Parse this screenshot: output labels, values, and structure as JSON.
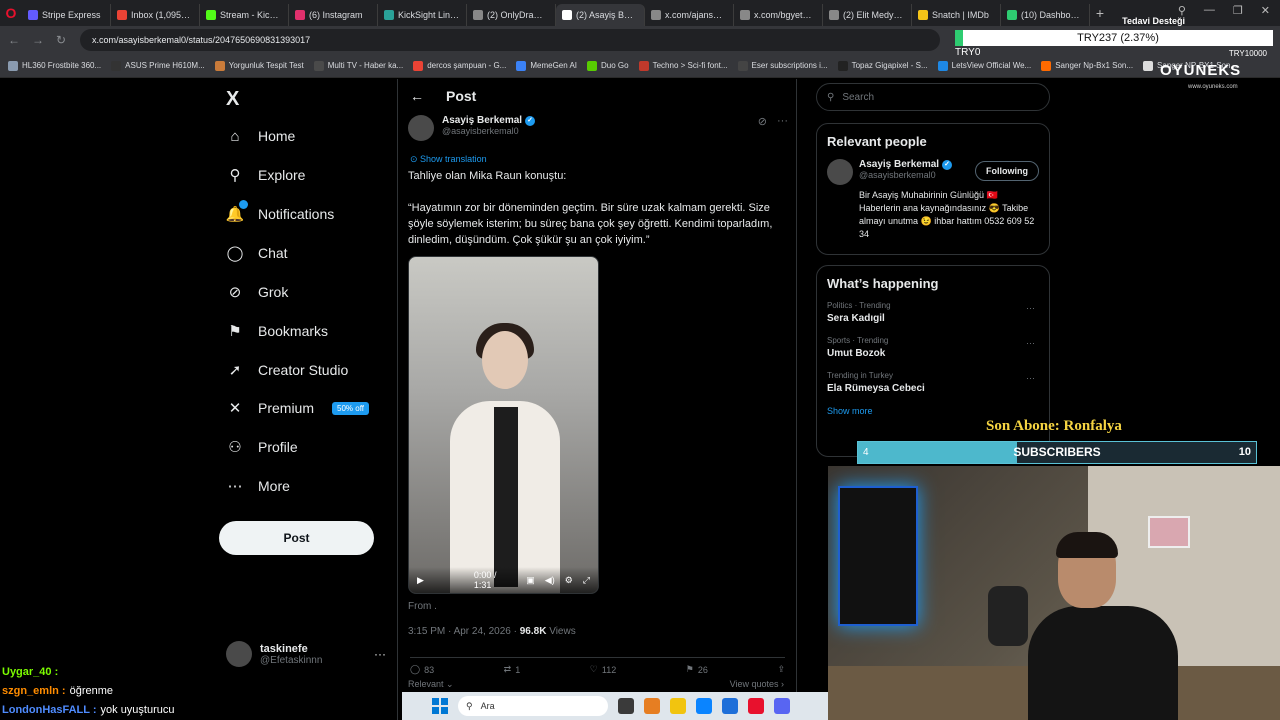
{
  "browser": {
    "tabs": [
      {
        "label": "Stripe Express",
        "color": "#635bff",
        "active": false
      },
      {
        "label": "Inbox (1,095) - kick",
        "color": "#ea4335",
        "active": false
      },
      {
        "label": "Stream - Kick Dashb",
        "color": "#53fc18",
        "active": false
      },
      {
        "label": "(6) Instagram",
        "color": "#e1306c",
        "active": false
      },
      {
        "label": "KickSight Link Dete",
        "color": "#2aa198",
        "active": false
      },
      {
        "label": "(2) OnlyDrama on X",
        "color": "#888888",
        "active": false
      },
      {
        "label": "(2) Asayiş Berkemal on X",
        "color": "#ffffff",
        "active": true
      },
      {
        "label": "x.com/ajansmuhbir",
        "color": "#888888",
        "active": false
      },
      {
        "label": "x.com/bgyethers/st",
        "color": "#888888",
        "active": false
      },
      {
        "label": "(2) Elit Medya on X",
        "color": "#888888",
        "active": false
      },
      {
        "label": "Snatch | IMDb",
        "color": "#f5c518",
        "active": false
      },
      {
        "label": "(10) Dashboard",
        "color": "#2ecc71",
        "active": false
      }
    ],
    "url": "x.com/asayisberkemal0/status/2047650690831393017",
    "bookmarks": [
      {
        "label": "HL360 Frostbite 360...",
        "color": "#8a9bb0"
      },
      {
        "label": "ASUS Prime H610M...",
        "color": "#333333"
      },
      {
        "label": "Yorgunluk Tespit Test",
        "color": "#c97b3a"
      },
      {
        "label": "Multi TV - Haber ka...",
        "color": "#4a4a4a"
      },
      {
        "label": "dercos şampuan - G...",
        "color": "#ea4335"
      },
      {
        "label": "MemeGen AI",
        "color": "#3b82f6"
      },
      {
        "label": "Duo Go",
        "color": "#58cc02"
      },
      {
        "label": "Techno > Sci-fi font...",
        "color": "#c0392b"
      },
      {
        "label": "Eser subscriptions i...",
        "color": "#444444"
      },
      {
        "label": "Topaz Gigapixel - S...",
        "color": "#222222"
      },
      {
        "label": "LetsView Official We...",
        "color": "#1e88e5"
      },
      {
        "label": "Sanger Np-Bx1 Son...",
        "color": "#ff6a00"
      },
      {
        "label": "Sanger NP-BX1 Son...",
        "color": "#dddddd"
      }
    ]
  },
  "fx_overlay": {
    "title": "Tedavi Desteği",
    "value": "TRY237 (2.37%)",
    "left": "TRY0",
    "right": "TRY10000",
    "progress_pct": 2.37,
    "accent": "#2ecc71"
  },
  "nav": {
    "logo": "X",
    "items": [
      {
        "label": "Home",
        "icon": "home-icon",
        "glyph": "⌂"
      },
      {
        "label": "Explore",
        "icon": "search-icon",
        "glyph": "⚲"
      },
      {
        "label": "Notifications",
        "icon": "bell-icon",
        "glyph": "🔔"
      },
      {
        "label": "Chat",
        "icon": "chat-icon",
        "glyph": "◯"
      },
      {
        "label": "Grok",
        "icon": "grok-icon",
        "glyph": "⊘"
      },
      {
        "label": "Bookmarks",
        "icon": "bookmark-icon",
        "glyph": "⚑"
      },
      {
        "label": "Creator Studio",
        "icon": "rocket-icon",
        "glyph": "➚"
      },
      {
        "label": "Premium",
        "icon": "x-icon",
        "glyph": "✕"
      },
      {
        "label": "Profile",
        "icon": "person-icon",
        "glyph": "⚇"
      },
      {
        "label": "More",
        "icon": "more-icon",
        "glyph": "⋯"
      }
    ],
    "premium_badge": "50% off",
    "post_button": "Post",
    "account": {
      "name": "taskinefe",
      "handle": "@Efetaskinnn"
    }
  },
  "post": {
    "header": "Post",
    "author_name": "Asayiş Berkemal",
    "author_handle": "@asayisberkemal0",
    "show_translation": "Show translation",
    "text_intro": "Tahliye olan Mika Raun konuştu:",
    "text_quote": "“Hayatımın zor bir döneminden geçtim. Bir süre uzak kalmam gerekti. Size şöyle söylemek isterim; bu süreç bana çok şey öğretti. Kendimi toparladım, dinledim, düşündüm. Çok şükür şu an çok iyiyim.”",
    "video_time": "0:00 / 1:31",
    "from": "From .",
    "time": "3:15 PM · Apr 24, 2026 ·",
    "views_count": "96.8K",
    "views_label": "Views",
    "replies": "83",
    "reposts": "1",
    "likes": "112",
    "bookmarks": "26",
    "relevant": "Relevant ⌄",
    "view_quotes": "View quotes ›"
  },
  "sidebar": {
    "search_placeholder": "Search",
    "relevant_title": "Relevant people",
    "person_name": "Asayiş Berkemal",
    "person_handle": "@asayisberkemal0",
    "follow_label": "Following",
    "bio": "Bir Asayiş Muhabirinin Günlüğü 🇹🇷 Haberlerin ana kaynağındasınız 😎 Takibe almayı unutma 😉 ihbar hattım 0532 609 52 34",
    "happening_title": "What’s happening",
    "trends": [
      {
        "category": "Politics · Trending",
        "name": "Sera Kadıgil"
      },
      {
        "category": "Sports · Trending",
        "name": "Umut Bozok"
      },
      {
        "category": "Trending in Turkey",
        "name": "Ela Rümeysa Cebeci"
      }
    ],
    "show_more": "Show more"
  },
  "stream": {
    "brand": "OYUNEKS",
    "brand_sub": "www.oyuneks.com",
    "sub_banner": "Son Abone: Ronfalya",
    "sub_label": "SUBSCRIBERS",
    "sub_current": "4",
    "sub_goal": "10",
    "sub_fraction": 0.4,
    "chat": [
      {
        "user": "Uygar_40 :",
        "msg": "",
        "color": "#7cfc00"
      },
      {
        "user": "szgn_emln :",
        "msg": "öğrenme",
        "color": "#ff8c00"
      },
      {
        "user": "LondonHasFALL :",
        "msg": "yok uyuşturucu",
        "color": "#4f8cff"
      }
    ]
  },
  "taskbar": {
    "search_placeholder": "Ara"
  }
}
